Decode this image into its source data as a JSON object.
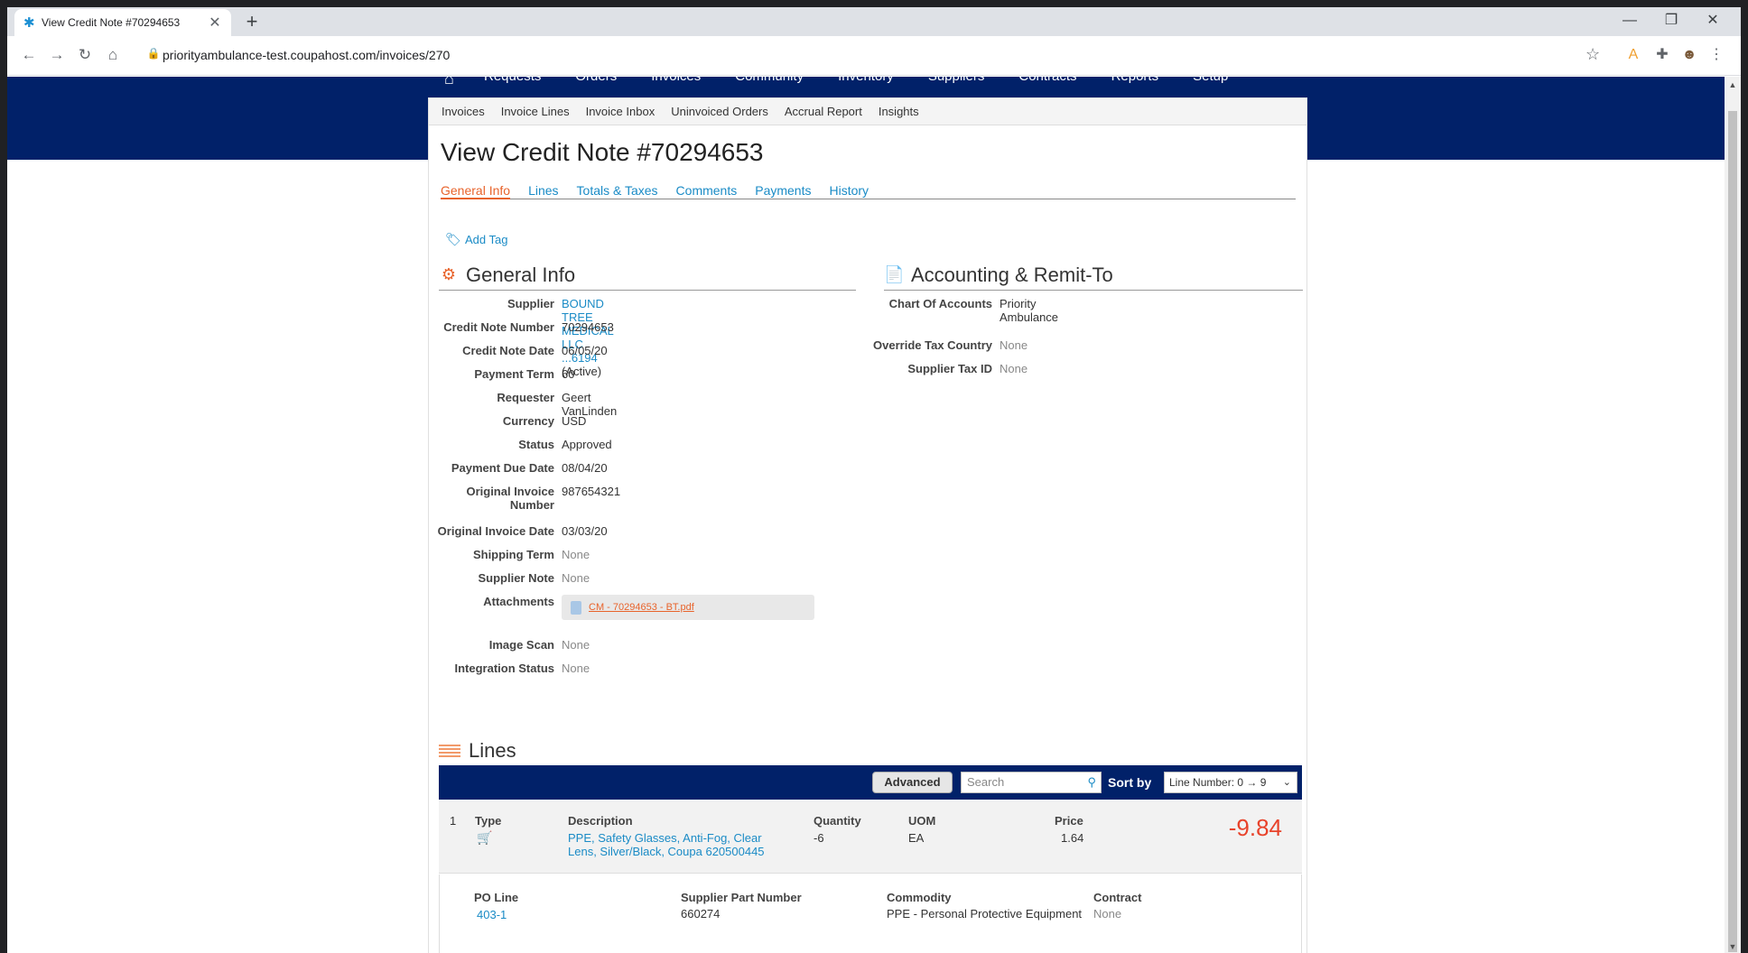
{
  "browser": {
    "tab_title": "View Credit Note #70294653",
    "url": "priorityambulance-test.coupahost.com/invoices/270"
  },
  "topnav": {
    "items": [
      "Requests",
      "Orders",
      "Invoices",
      "Community",
      "Inventory",
      "Suppliers",
      "Contracts",
      "Reports",
      "Setup"
    ]
  },
  "subnav": [
    "Invoices",
    "Invoice Lines",
    "Invoice Inbox",
    "Uninvoiced Orders",
    "Accrual Report",
    "Insights"
  ],
  "page": {
    "title": "View Credit Note #70294653",
    "tabs": [
      "General Info",
      "Lines",
      "Totals & Taxes",
      "Comments",
      "Payments",
      "History"
    ],
    "add_tag": "Add Tag"
  },
  "general_info": {
    "title": "General Info",
    "supplier_label": "Supplier",
    "supplier_link": "BOUND TREE MEDICAL LLC ...6194",
    "supplier_status": "(Active)",
    "credit_note_number_label": "Credit Note Number",
    "credit_note_number": "70294653",
    "credit_note_date_label": "Credit Note Date",
    "credit_note_date": "06/05/20",
    "payment_term_label": "Payment Term",
    "payment_term": "60",
    "requester_label": "Requester",
    "requester": "Geert VanLinden",
    "currency_label": "Currency",
    "currency": "USD",
    "status_label": "Status",
    "status": "Approved",
    "payment_due_date_label": "Payment Due Date",
    "payment_due_date": "08/04/20",
    "original_invoice_number_label_1": "Original Invoice",
    "original_invoice_number_label_2": "Number",
    "original_invoice_number": "987654321",
    "original_invoice_date_label": "Original Invoice Date",
    "original_invoice_date": "03/03/20",
    "shipping_term_label": "Shipping Term",
    "shipping_term": "None",
    "supplier_note_label": "Supplier Note",
    "supplier_note": "None",
    "attachments_label": "Attachments",
    "attachment_file": "CM - 70294653 - BT.pdf",
    "image_scan_label": "Image Scan",
    "image_scan": "None",
    "integration_status_label": "Integration Status",
    "integration_status": "None"
  },
  "accounting": {
    "title": "Accounting & Remit-To",
    "chart_of_accounts_label": "Chart Of Accounts",
    "chart_of_accounts": "Priority Ambulance",
    "override_tax_country_label": "Override Tax Country",
    "override_tax_country": "None",
    "supplier_tax_id_label": "Supplier Tax ID",
    "supplier_tax_id": "None"
  },
  "lines": {
    "title": "Lines",
    "advanced_button": "Advanced",
    "search_placeholder": "Search",
    "sort_by_label": "Sort by",
    "sort_value": "Line Number: 0 → 9",
    "line": {
      "number": "1",
      "type_label": "Type",
      "description_label": "Description",
      "description_1": "PPE, Safety Glasses, Anti-Fog, Clear",
      "description_2": "Lens, Silver/Black, Coupa 620500445",
      "quantity_label": "Quantity",
      "quantity": "-6",
      "uom_label": "UOM",
      "uom": "EA",
      "price_label": "Price",
      "price": "1.64",
      "total": "-9.84",
      "po_line_label": "PO Line",
      "po_line": "403-1",
      "supplier_part_label": "Supplier Part Number",
      "supplier_part": "660274",
      "commodity_label": "Commodity",
      "commodity": "PPE - Personal Protective Equipment",
      "contract_label": "Contract",
      "contract": "None"
    }
  }
}
